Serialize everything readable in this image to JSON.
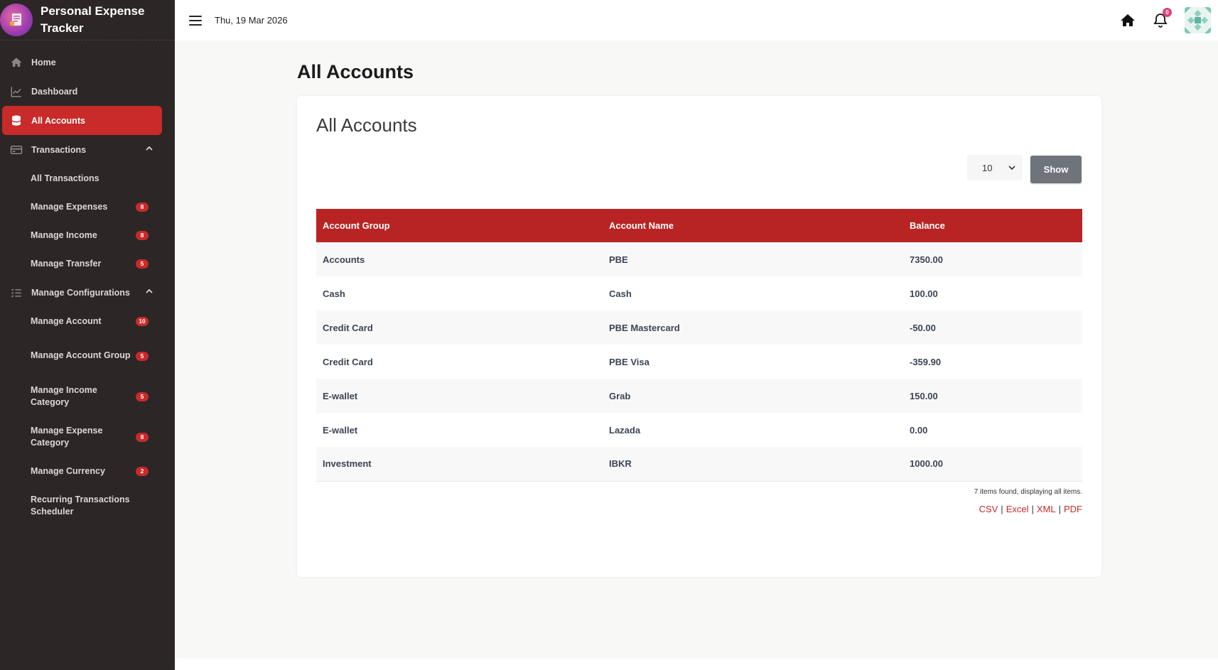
{
  "app": {
    "title": "Personal Expense Tracker",
    "date": "Thu, 19 Mar 2026",
    "notification_count": "0"
  },
  "sidebar": {
    "items": [
      {
        "label": "Home",
        "icon": "home-icon"
      },
      {
        "label": "Dashboard",
        "icon": "chart-line-icon"
      },
      {
        "label": "All Accounts",
        "icon": "database-icon",
        "active": true
      },
      {
        "label": "Transactions",
        "icon": "credit-card-icon"
      }
    ],
    "transactions": [
      {
        "label": "All Transactions",
        "badge": ""
      },
      {
        "label": "Manage Expenses",
        "badge": "8"
      },
      {
        "label": "Manage Income",
        "badge": "8"
      },
      {
        "label": "Manage Transfer",
        "badge": "5"
      }
    ],
    "config_label": "Manage Configurations",
    "config": [
      {
        "label": "Manage Account",
        "badge": "10"
      },
      {
        "label": "Manage Account Group",
        "badge": "5"
      },
      {
        "label": "Manage Income Category",
        "badge": "5"
      },
      {
        "label": "Manage Expense Category",
        "badge": "8"
      },
      {
        "label": "Manage Currency",
        "badge": "2"
      },
      {
        "label": "Recurring Transactions Scheduler",
        "badge": ""
      }
    ]
  },
  "main": {
    "page_title": "All Accounts",
    "card_title": "All Accounts",
    "page_size": "10",
    "show_label": "Show",
    "table": {
      "headers": [
        "Account Group",
        "Account Name",
        "Balance"
      ],
      "rows": [
        [
          "Accounts",
          "PBE",
          "7350.00"
        ],
        [
          "Cash",
          "Cash",
          "100.00"
        ],
        [
          "Credit Card",
          "PBE Mastercard",
          "-50.00"
        ],
        [
          "Credit Card",
          "PBE Visa",
          "-359.90"
        ],
        [
          "E-wallet",
          "Grab",
          "150.00"
        ],
        [
          "E-wallet",
          "Lazada",
          "0.00"
        ],
        [
          "Investment",
          "IBKR",
          "1000.00"
        ]
      ]
    },
    "summary": "7 items found, displaying all items.",
    "exports": [
      "CSV",
      "Excel",
      "XML",
      "PDF"
    ]
  },
  "colors": {
    "accent": "#c92a2a",
    "table_header": "#b82424",
    "sidebar_bg": "#2c2626"
  }
}
